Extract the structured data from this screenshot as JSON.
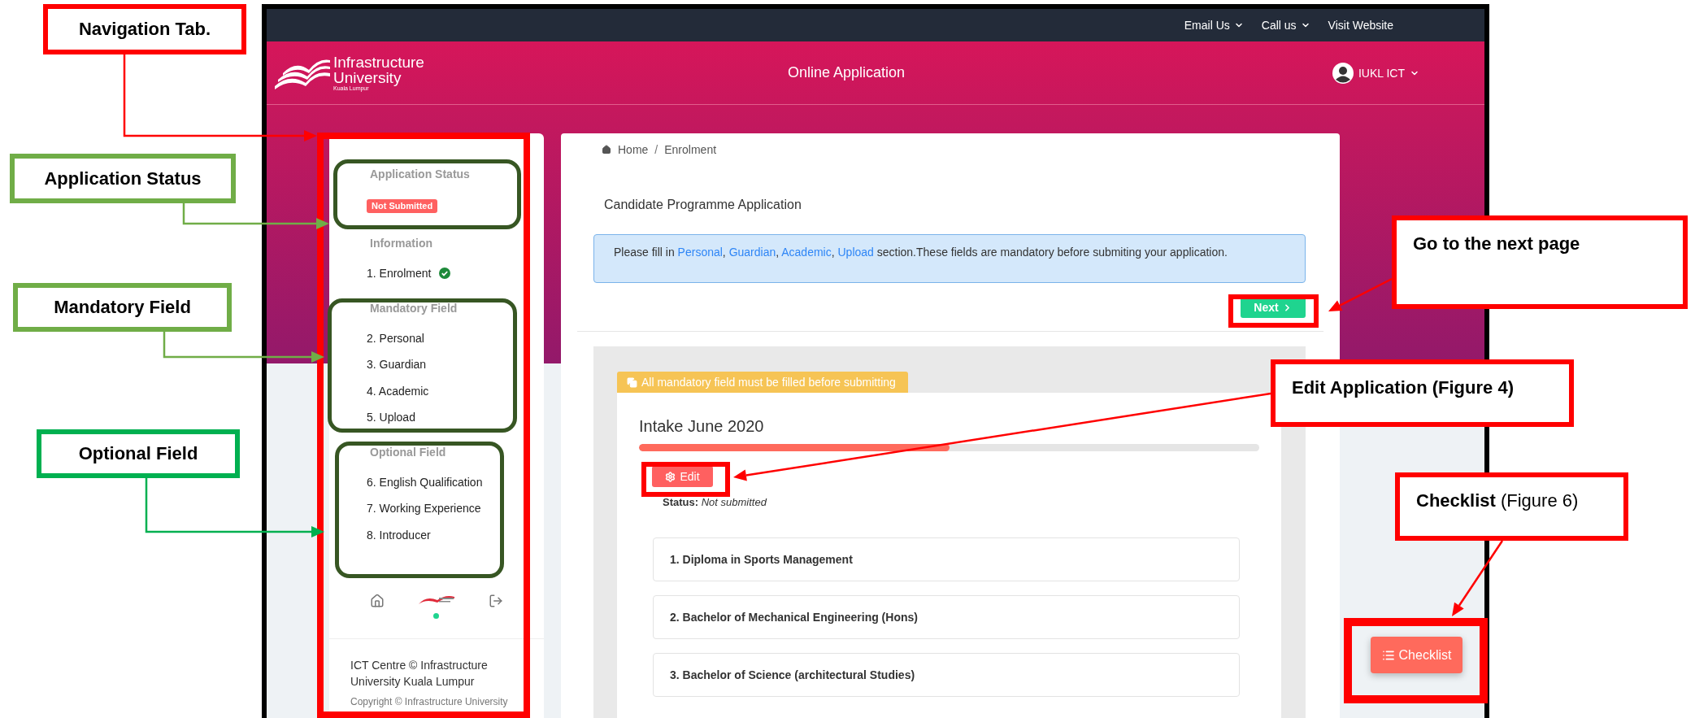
{
  "top_bar": {
    "links": [
      {
        "label": "Email Us",
        "dropdown": true
      },
      {
        "label": "Call us",
        "dropdown": true
      },
      {
        "label": "Visit Website",
        "dropdown": false
      }
    ]
  },
  "header": {
    "logo": {
      "line1": "Infrastructure",
      "line2": "University",
      "line3": "Kuala Lumpur"
    },
    "title": "Online Application",
    "user": "IUKL ICT"
  },
  "sidebar": {
    "sections": [
      {
        "heading": "Application Status",
        "badge": "Not Submitted"
      },
      {
        "heading": "Information",
        "items": [
          {
            "label": "1. Enrolment",
            "done": true
          }
        ]
      },
      {
        "heading": "Mandatory Field",
        "items": [
          {
            "label": "2. Personal",
            "done": false
          },
          {
            "label": "3. Guardian",
            "done": false
          },
          {
            "label": "4. Academic",
            "done": false
          },
          {
            "label": "5. Upload",
            "done": false
          }
        ]
      },
      {
        "heading": "Optional Field",
        "items": [
          {
            "label": "6. English Qualification",
            "done": false
          },
          {
            "label": "7. Working Experience",
            "done": false
          },
          {
            "label": "8. Introducer",
            "done": false
          }
        ]
      }
    ],
    "footer": {
      "credit": "ICT Centre © Infrastructure University Kuala Lumpur",
      "copyright": "Copyright © Infrastructure University"
    }
  },
  "main": {
    "breadcrumb": [
      "Home",
      "Enrolment"
    ],
    "breadcrumb_separator": "/",
    "heading": "Candidate Programme Application",
    "notice": [
      {
        "text": "Please fill in ",
        "link": false
      },
      {
        "text": "Personal",
        "link": true
      },
      {
        "text": ", ",
        "link": false
      },
      {
        "text": "Guardian",
        "link": true
      },
      {
        "text": ", ",
        "link": false
      },
      {
        "text": "Academic",
        "link": true
      },
      {
        "text": ", ",
        "link": false
      },
      {
        "text": "Upload",
        "link": true
      },
      {
        "text": " section.These fields are mandatory before submiting your application.",
        "link": false
      }
    ],
    "next_button": "Next",
    "application": {
      "tab": "All mandatory field must be filled before submitting",
      "intake": "Intake June 2020",
      "level": 0.5,
      "edit_button": "Edit",
      "status_label": "Status:",
      "status": "Not submitted",
      "programmes": [
        "1. Diploma in Sports Management",
        "2. Bachelor of Mechanical Engineering (Hons)",
        "3. Bachelor of Science (architectural Studies)"
      ]
    }
  },
  "checklist_button": "Checklist",
  "annotations": [
    {
      "text": "Navigation Tab.",
      "color": "#ff0000"
    },
    {
      "text": "Application Status",
      "color": "#70ad47"
    },
    {
      "text": "Mandatory Field",
      "color": "#70ad47"
    },
    {
      "text": "Optional Field",
      "color": "#00b050"
    },
    {
      "text": "Go to the next page",
      "color": "#ff0000"
    },
    {
      "text": "Edit Application (Figure 4)",
      "color": "#ff0000"
    },
    {
      "text": "**Checklist** (Figure 6)",
      "color": "#ff0000"
    }
  ]
}
